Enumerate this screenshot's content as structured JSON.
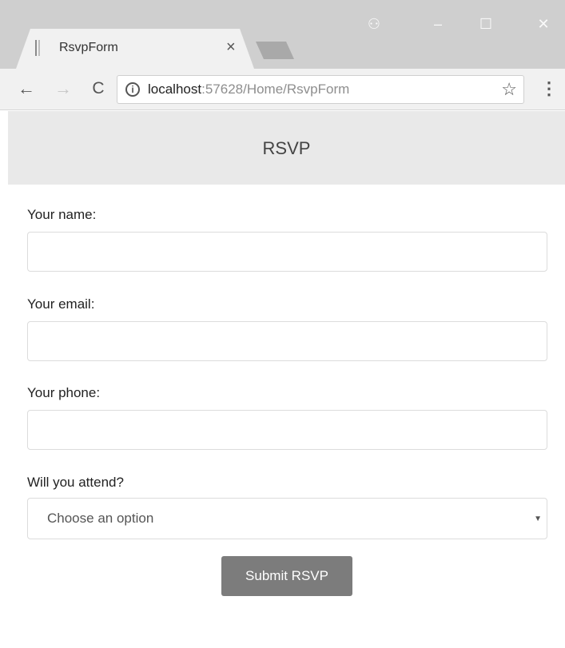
{
  "browser": {
    "tab_title": "RsvpForm",
    "tab_close": "×",
    "window_controls": {
      "profile": "⚇",
      "minimize": "–",
      "maximize": "☐",
      "close": "✕"
    },
    "nav": {
      "back": "←",
      "forward": "→",
      "reload": "C"
    },
    "address": {
      "host": "localhost",
      "path": ":57628/Home/RsvpForm"
    },
    "icons": {
      "info": "i",
      "star": "☆",
      "menu": "⋮"
    }
  },
  "page": {
    "title": "RSVP",
    "fields": {
      "name_label": "Your name:",
      "name_value": "",
      "email_label": "Your email:",
      "email_value": "",
      "phone_label": "Your phone:",
      "phone_value": "",
      "attend_label": "Will you attend?",
      "attend_selected": "Choose an option",
      "attend_caret": "▼"
    },
    "submit_label": "Submit RSVP"
  }
}
